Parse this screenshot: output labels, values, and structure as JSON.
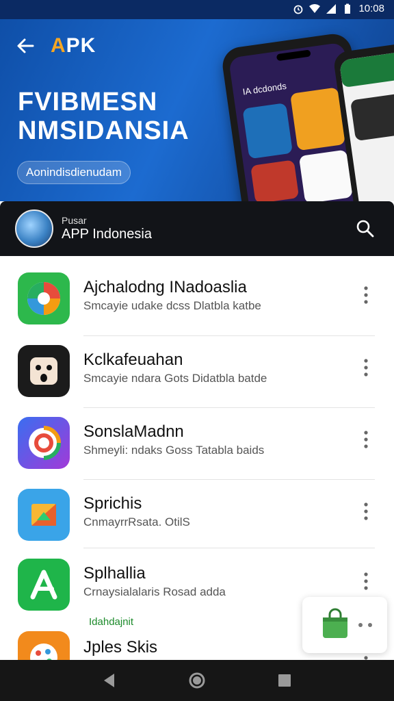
{
  "status_bar": {
    "time": "10:08"
  },
  "hero": {
    "logo_accent": "A",
    "logo_rest": "PK",
    "title_line1": "FVIBMESN",
    "title_line2": "NMSIDANSIA",
    "pill": "Aonindisdienudam",
    "phone_title": "IA dcdonds"
  },
  "app_header": {
    "subtitle": "Pusar",
    "title": "APP Indonesia"
  },
  "apps": [
    {
      "title": "Ajchalodng INadoaslia",
      "subtitle": "Smcayie udake dcss Dlatbla katbe",
      "icon": "colorful-flower-icon",
      "bg": "#2db84c"
    },
    {
      "title": "Kclkafeuahan",
      "subtitle": "Smcayie ndara Gots Didatbla batde",
      "icon": "face-icon",
      "bg": "#1b1b1b"
    },
    {
      "title": "SonslaMadnn",
      "subtitle": "Shmeyli: ndaks Goss Tatabla baids",
      "icon": "swirl-icon",
      "bg": "#5a4bd8"
    },
    {
      "title": "Sprichis",
      "subtitle": "CnmayrrRsata. OtilS",
      "icon": "folder-icon",
      "bg": "#3aa4e8"
    },
    {
      "title": "Splhallia",
      "subtitle": "Crnaysialalaris Rosad adda",
      "icon": "a-letter-icon",
      "bg": "#1fb54a"
    },
    {
      "title": "Jples Skis",
      "subtitle": "",
      "icon": "palette-icon",
      "bg": "#f28a1c"
    }
  ],
  "install_tag": "Idahdajnit",
  "colors": {
    "hero": "#1c6bd0",
    "header": "#121418",
    "accent_green": "#1b8a2a"
  }
}
